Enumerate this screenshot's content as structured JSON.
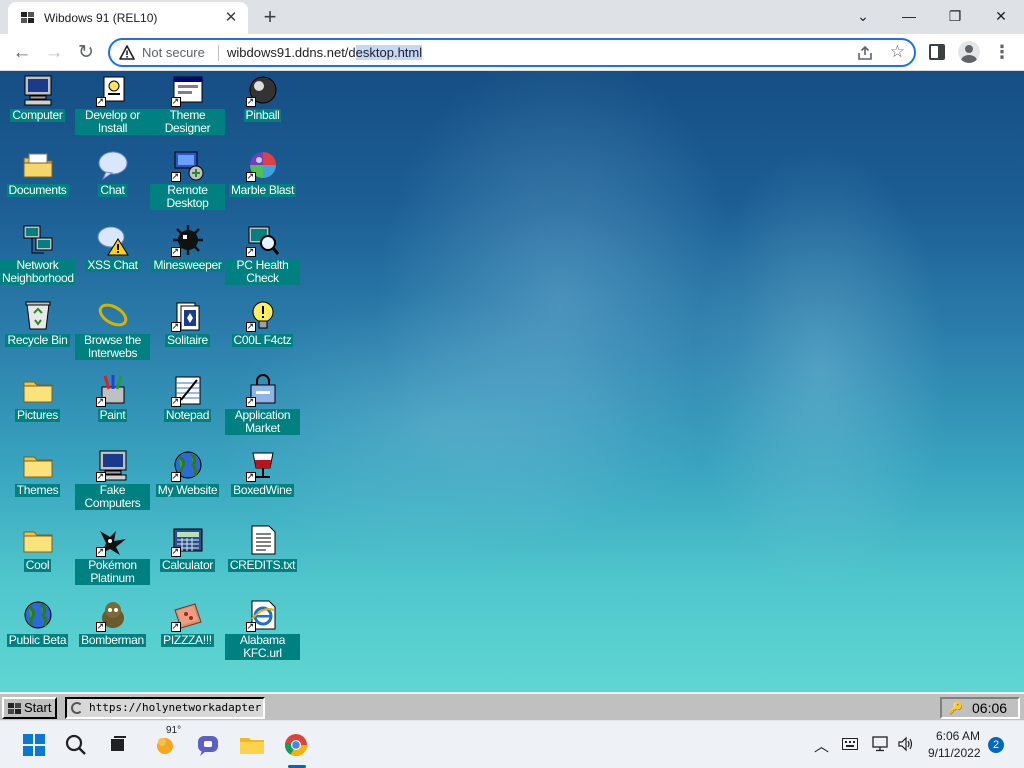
{
  "browser": {
    "tab_title": "Wibdows 91 (REL10)",
    "tab_close": "✕",
    "new_tab": "+",
    "minimize": "⌄",
    "maximize": "—",
    "restore": "❐",
    "close": "✕",
    "back": "←",
    "forward": "→",
    "reload": "↻",
    "security_label": "Not secure",
    "url_prefix": "wibdows91.ddns.net/d",
    "url_selected": "esktop.html",
    "star": "☆",
    "menu": "⋮"
  },
  "desktop": {
    "icons": [
      {
        "label": "Computer",
        "icon": "computer-icon"
      },
      {
        "label": "Develop or Install",
        "icon": "develop-install-icon"
      },
      {
        "label": "Theme Designer",
        "icon": "theme-designer-icon"
      },
      {
        "label": "Pinball",
        "icon": "pinball-icon"
      },
      {
        "label": "Documents",
        "icon": "documents-folder-icon"
      },
      {
        "label": "Chat",
        "icon": "chat-bubble-icon"
      },
      {
        "label": "Remote Desktop",
        "icon": "remote-desktop-icon"
      },
      {
        "label": "Marble Blast",
        "icon": "marble-icon"
      },
      {
        "label": "Network Neighborhood",
        "icon": "network-icon"
      },
      {
        "label": "XSS Chat",
        "icon": "warning-chat-icon"
      },
      {
        "label": "Minesweeper",
        "icon": "mine-icon"
      },
      {
        "label": "PC Health Check",
        "icon": "health-check-icon"
      },
      {
        "label": "Recycle Bin",
        "icon": "recycle-bin-icon"
      },
      {
        "label": "Browse the Interwebs",
        "icon": "browser-ring-icon"
      },
      {
        "label": "Solitaire",
        "icon": "cards-icon"
      },
      {
        "label": "C00L F4ctz",
        "icon": "lightbulb-icon"
      },
      {
        "label": "Pictures",
        "icon": "folder-icon"
      },
      {
        "label": "Paint",
        "icon": "paint-icon"
      },
      {
        "label": "Notepad",
        "icon": "notepad-icon"
      },
      {
        "label": "Application Market",
        "icon": "market-icon"
      },
      {
        "label": "Themes",
        "icon": "folder-icon"
      },
      {
        "label": "Fake Computers",
        "icon": "computer-icon"
      },
      {
        "label": "My Website",
        "icon": "globe-icon"
      },
      {
        "label": "BoxedWine",
        "icon": "wine-glass-icon"
      },
      {
        "label": "Cool",
        "icon": "folder-icon"
      },
      {
        "label": "Pokémon Platinum",
        "icon": "pokemon-icon"
      },
      {
        "label": "Calculator",
        "icon": "calculator-icon"
      },
      {
        "label": "CREDITS.txt",
        "icon": "text-file-icon"
      },
      {
        "label": "Public Beta",
        "icon": "globe-icon"
      },
      {
        "label": "Bomberman",
        "icon": "bomberman-icon"
      },
      {
        "label": "PIZZZA!!!",
        "icon": "pizza-box-icon"
      },
      {
        "label": "Alabama KFC.url",
        "icon": "ie-link-icon"
      }
    ]
  },
  "w91_taskbar": {
    "start_label": "Start",
    "task_label": "https://holynetworkadapter",
    "clock": "06:06"
  },
  "os_taskbar": {
    "temperature": "91°",
    "time": "6:06 AM",
    "date": "9/11/2022",
    "notifications": "2"
  },
  "colors": {
    "accent": "#1a73e8",
    "label_bg": "#008080",
    "win91_gray": "#c0c0c0"
  }
}
